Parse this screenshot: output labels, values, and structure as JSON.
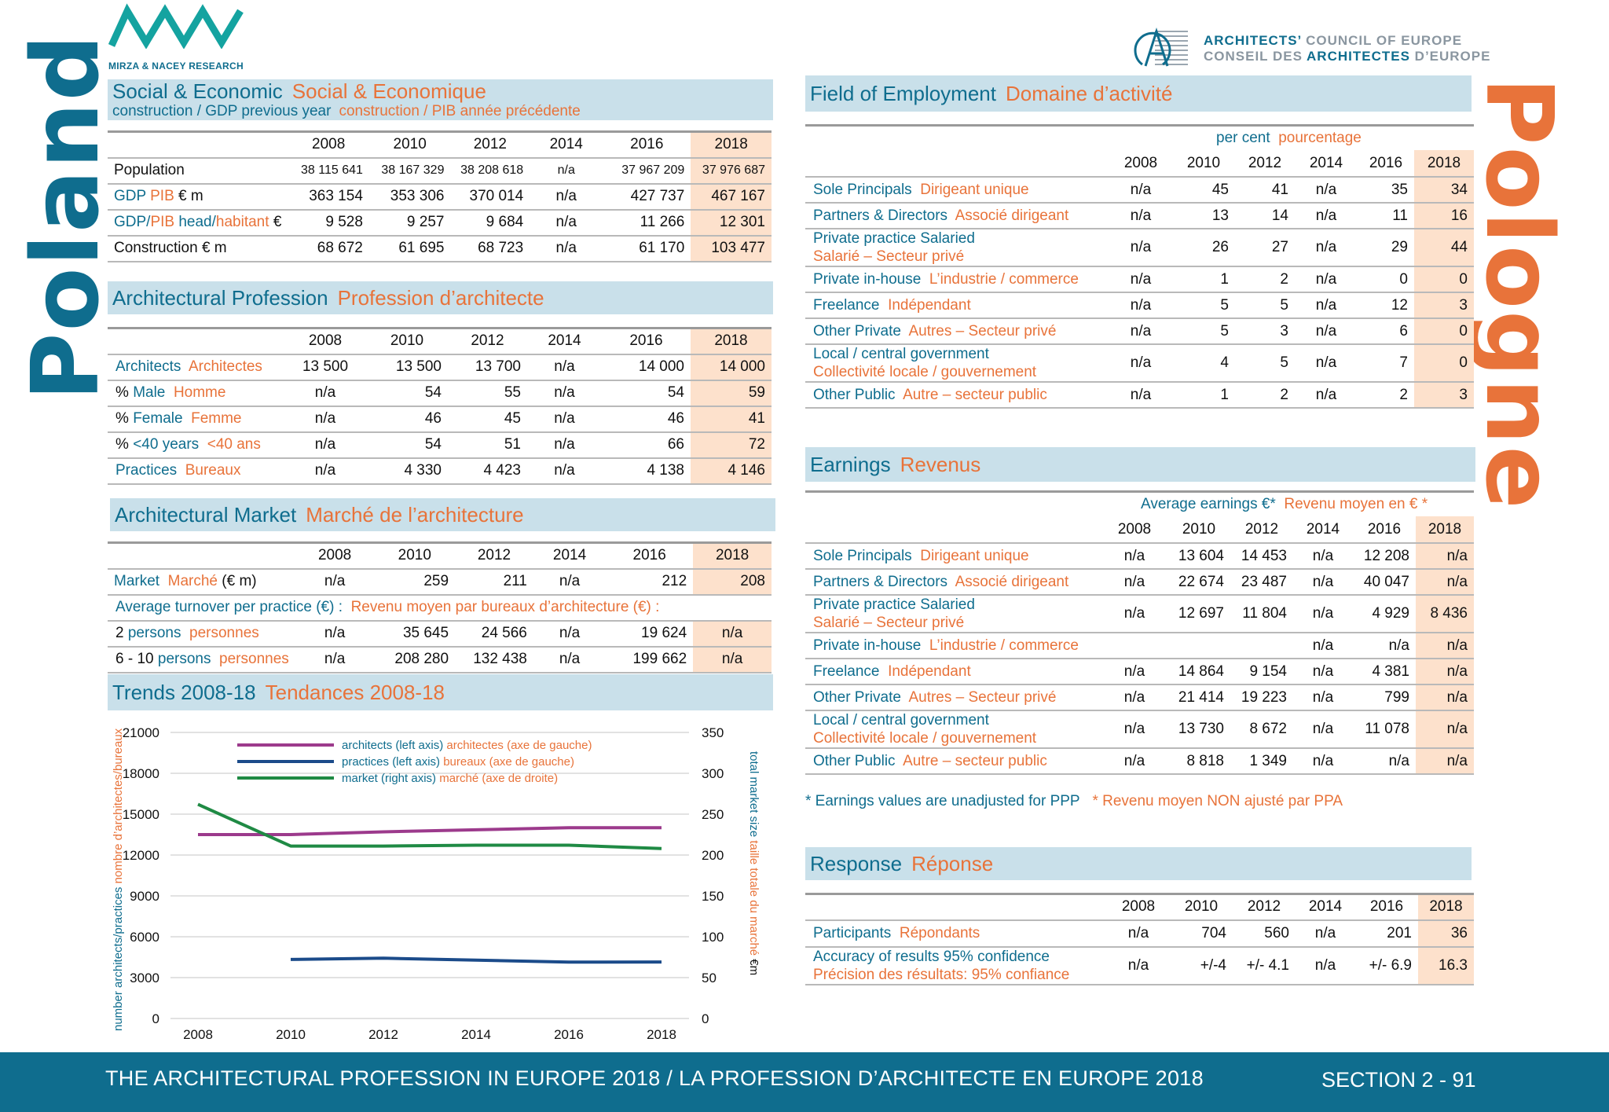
{
  "header": {
    "left_logo_text": "MIRZA & NACEY RESEARCH",
    "right_logo_en": [
      "ARCHITECTS’",
      " COUNCIL OF EUROPE"
    ],
    "right_logo_fr": [
      "CONSEIL DES ",
      "ARCHITECTES",
      " D’EUROPE"
    ]
  },
  "country": {
    "en": "Poland",
    "fr": "Pologne"
  },
  "colors": {
    "teal": "#0f6d8e",
    "orange": "#e8733a",
    "band": "#c9e0ea",
    "highlight": "#fde1cc"
  },
  "social": {
    "title_en": "Social & Economic",
    "title_fr": "Social & Economique",
    "sub_en": "construction / GDP previous year",
    "sub_fr": "construction / PIB année précédente",
    "years": [
      "2008",
      "2010",
      "2012",
      "2014",
      "2016",
      "2018"
    ],
    "rows": [
      {
        "label": "Population",
        "values": [
          "38 115 641",
          "38 167 329",
          "38 208 618",
          "n/a",
          "37 967 209",
          "37 976 687"
        ]
      },
      {
        "label_a": "GDP",
        "label_b": "PIB",
        "label_c": "€ m",
        "values": [
          "363 154",
          "353 306",
          "370 014",
          "n/a",
          "427 737",
          "467 167"
        ]
      },
      {
        "label_a": "GDP/",
        "label_b": "PIB",
        "label_a2": "head/",
        "label_b2": "habitant",
        "label_c": "€",
        "values": [
          "9 528",
          "9 257",
          "9 684",
          "n/a",
          "11 266",
          "12 301"
        ]
      },
      {
        "label": "Construction € m",
        "values": [
          "68 672",
          "61 695",
          "68 723",
          "n/a",
          "61 170",
          "103 477"
        ]
      }
    ]
  },
  "profession": {
    "title_en": "Architectural Profession",
    "title_fr": "Profession d’architecte",
    "years": [
      "2008",
      "2010",
      "2012",
      "2014",
      "2016",
      "2018"
    ],
    "rows": [
      {
        "en": "Architects",
        "fr": "Architectes",
        "values": [
          "13 500",
          "13 500",
          "13 700",
          "n/a",
          "14 000",
          "14 000"
        ]
      },
      {
        "en": "Male",
        "fr": "Homme",
        "prefix": "% ",
        "values": [
          "n/a",
          "54",
          "55",
          "n/a",
          "54",
          "59"
        ]
      },
      {
        "en": "Female",
        "fr": "Femme",
        "prefix": "% ",
        "values": [
          "n/a",
          "46",
          "45",
          "n/a",
          "46",
          "41"
        ]
      },
      {
        "en": "<40 years",
        "fr": "<40 ans",
        "prefix": "% ",
        "values": [
          "n/a",
          "54",
          "51",
          "n/a",
          "66",
          "72"
        ]
      },
      {
        "en": "Practices",
        "fr": "Bureaux",
        "values": [
          "n/a",
          "4 330",
          "4 423",
          "n/a",
          "4 138",
          "4 146"
        ]
      }
    ]
  },
  "market": {
    "title_en": "Architectural Market",
    "title_fr": "Marché de l’architecture",
    "years": [
      "2008",
      "2010",
      "2012",
      "2014",
      "2016",
      "2018"
    ],
    "market_row": {
      "en": "Market",
      "fr": "Marché",
      "unit": "(€ m)",
      "values": [
        "n/a",
        "259",
        "211",
        "n/a",
        "212",
        "208"
      ]
    },
    "turnover_en": "Average turnover per practice (€) :",
    "turnover_fr": "Revenu moyen par bureaux d’architecture (€) :",
    "rows": [
      {
        "num": "2",
        "en": "persons",
        "fr": "personnes",
        "values": [
          "n/a",
          "35 645",
          "24 566",
          "n/a",
          "19 624",
          "n/a"
        ]
      },
      {
        "num": "6 - 10",
        "en": "persons",
        "fr": "personnes",
        "values": [
          "n/a",
          "208 280",
          "132 438",
          "n/a",
          "199 662",
          "n/a"
        ]
      }
    ]
  },
  "trends": {
    "title_en": "Trends 2008-18",
    "title_fr": "Tendances 2008-18",
    "left_axis_en": "number architects/practices",
    "left_axis_fr": "nombre d’architectes/bureaux",
    "right_axis_en": "total market size",
    "right_axis_fr": "taille totale du marché",
    "right_axis_unit": "€m"
  },
  "chart_data": {
    "type": "line",
    "x": [
      2008,
      2010,
      2012,
      2014,
      2016,
      2018
    ],
    "ylim_left": [
      0,
      21000
    ],
    "yticks_left": [
      "0",
      "3000",
      "6000",
      "9000",
      "12000",
      "15000",
      "18000",
      "21000"
    ],
    "ylim_right": [
      0,
      350
    ],
    "yticks_right": [
      "0",
      "50",
      "100",
      "150",
      "200",
      "250",
      "300",
      "350"
    ],
    "xticks": [
      "2008",
      "2010",
      "2012",
      "2014",
      "2016",
      "2018"
    ],
    "grid": true,
    "legend_position": "top",
    "series": [
      {
        "name_en": "architects (left axis)",
        "name_fr": "architectes (axe de gauche)",
        "axis": "left",
        "color": "#9c3a8c",
        "values": [
          13500,
          13500,
          13700,
          13850,
          14000,
          14000
        ]
      },
      {
        "name_en": "practices (left axis)",
        "name_fr": "bureaux (axe de gauche)",
        "axis": "left",
        "color": "#1b4b8a",
        "values": [
          null,
          4330,
          4423,
          4280,
          4138,
          4146
        ]
      },
      {
        "name_en": "market (right axis)",
        "name_fr": "marché (axe de droite)",
        "axis": "right",
        "color": "#1f8a44",
        "values": [
          262,
          211,
          211,
          212,
          212,
          208
        ]
      }
    ]
  },
  "employment": {
    "title_en": "Field of Employment",
    "title_fr": "Domaine d’activité",
    "unit_en": "per cent",
    "unit_fr": "pourcentage",
    "years": [
      "2008",
      "2010",
      "2012",
      "2014",
      "2016",
      "2018"
    ],
    "rows": [
      {
        "en": "Sole Principals",
        "fr": "Dirigeant unique",
        "values": [
          "n/a",
          "45",
          "41",
          "n/a",
          "35",
          "34"
        ]
      },
      {
        "en": "Partners & Directors",
        "fr": "Associé  dirigeant",
        "values": [
          "n/a",
          "13",
          "14",
          "n/a",
          "11",
          "16"
        ]
      },
      {
        "en": "Private practice Salaried",
        "fr": "Salarié – Secteur privé",
        "two_line": true,
        "values": [
          "n/a",
          "26",
          "27",
          "n/a",
          "29",
          "44"
        ]
      },
      {
        "en": "Private in-house",
        "fr": "L’industrie / commerce",
        "values": [
          "n/a",
          "1",
          "2",
          "n/a",
          "0",
          "0"
        ]
      },
      {
        "en": "Freelance",
        "fr": "Indépendant",
        "values": [
          "n/a",
          "5",
          "5",
          "n/a",
          "12",
          "3"
        ]
      },
      {
        "en": "Other Private",
        "fr": "Autres – Secteur privé",
        "values": [
          "n/a",
          "5",
          "3",
          "n/a",
          "6",
          "0"
        ]
      },
      {
        "en": "Local / central government",
        "fr": "Collectivité locale / gouvernement",
        "two_line": true,
        "values": [
          "n/a",
          "4",
          "5",
          "n/a",
          "7",
          "0"
        ]
      },
      {
        "en": "Other Public",
        "fr": "Autre – secteur public",
        "values": [
          "n/a",
          "1",
          "2",
          "n/a",
          "2",
          "3"
        ]
      }
    ]
  },
  "earnings": {
    "title_en": "Earnings",
    "title_fr": "Revenus",
    "unit_en": "Average earnings €*",
    "unit_fr": "Revenu moyen en € *",
    "years": [
      "2008",
      "2010",
      "2012",
      "2014",
      "2016",
      "2018"
    ],
    "rows": [
      {
        "en": "Sole Principals",
        "fr": "Dirigeant unique",
        "values": [
          "n/a",
          "13 604",
          "14 453",
          "n/a",
          "12 208",
          "n/a"
        ]
      },
      {
        "en": "Partners & Directors",
        "fr": "Associé  dirigeant",
        "values": [
          "n/a",
          "22 674",
          "23 487",
          "n/a",
          "40 047",
          "n/a"
        ]
      },
      {
        "en": "Private practice Salaried",
        "fr": "Salarié – Secteur privé",
        "two_line": true,
        "values": [
          "n/a",
          "12 697",
          "11 804",
          "n/a",
          "4 929",
          "8 436"
        ]
      },
      {
        "en": "Private in-house",
        "fr": "L’industrie / commerce",
        "values": [
          "",
          "",
          "",
          "n/a",
          "n/a",
          "n/a"
        ]
      },
      {
        "en": "Freelance",
        "fr": "Indépendant",
        "values": [
          "n/a",
          "14 864",
          "9 154",
          "n/a",
          "4 381",
          "n/a"
        ]
      },
      {
        "en": "Other Private",
        "fr": "Autres – Secteur privé",
        "values": [
          "n/a",
          "21 414",
          "19 223",
          "n/a",
          "799",
          "n/a"
        ]
      },
      {
        "en": "Local / central government",
        "fr": "Collectivité locale / gouvernement",
        "two_line": true,
        "values": [
          "n/a",
          "13 730",
          "8 672",
          "n/a",
          "11 078",
          "n/a"
        ]
      },
      {
        "en": "Other Public",
        "fr": "Autre – secteur public",
        "values": [
          "n/a",
          "8 818",
          "1 349",
          "n/a",
          "n/a",
          "n/a"
        ]
      }
    ],
    "note_en": "* Earnings values are unadjusted for PPP",
    "note_fr": "* Revenu moyen NON ajusté par PPA"
  },
  "response": {
    "title_en": "Response",
    "title_fr": "Réponse",
    "years": [
      "2008",
      "2010",
      "2012",
      "2014",
      "2016",
      "2018"
    ],
    "rows": [
      {
        "en": "Participants",
        "fr": "Répondants",
        "values": [
          "n/a",
          "704",
          "560",
          "n/a",
          "201",
          "36"
        ]
      },
      {
        "en": "Accuracy of results 95% confidence",
        "fr": "Précision des résultats: 95% confiance",
        "two_line": true,
        "values": [
          "n/a",
          "+/-4",
          "+/- 4.1",
          "n/a",
          "+/- 6.9",
          "16.3"
        ]
      }
    ]
  },
  "footer": {
    "title": "THE ARCHITECTURAL PROFESSION IN EUROPE 2018 / LA PROFESSION D’ARCHITECTE EN EUROPE 2018",
    "section": "SECTION 2 - 91"
  }
}
